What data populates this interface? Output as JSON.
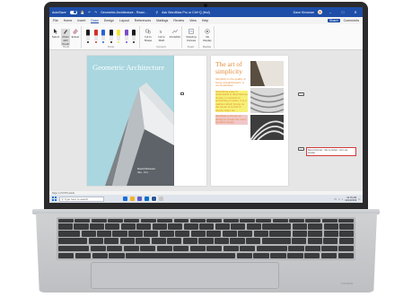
{
  "device": {
    "logo": "Lenovo"
  },
  "word": {
    "titlebar": {
      "autosave_label": "AutoSave",
      "autosave_state": "On",
      "doc_title": "Geometric Architecture - Read...",
      "search_placeholder": "Ask WordMax Pro or Ctrl+Q (find)",
      "user_name": "Dave Kinsman"
    },
    "tabs": [
      "File",
      "Home",
      "Insert",
      "Draw",
      "Design",
      "Layout",
      "References",
      "Mailings",
      "Review",
      "View",
      "Help"
    ],
    "active_tab": "Draw",
    "share_label": "Share",
    "comments_label": "Comments",
    "ribbon": {
      "groups": [
        {
          "label": "Tools",
          "tools": [
            "Select",
            "Draw with Touch",
            "Eraser"
          ]
        },
        {
          "label": "Pens"
        },
        {
          "label": "Convert",
          "tools": [
            "Ink to Shape",
            "Ink to Math",
            "Ink Editor"
          ]
        },
        {
          "label": "Insert",
          "tools": [
            "Drawing Canvas"
          ]
        },
        {
          "label": "Replay",
          "tools": [
            "Ink Replay"
          ]
        }
      ],
      "pen_colors": [
        "#1c1c1c",
        "#d2312c",
        "#2a61d6",
        "#1c1c1c",
        "#f5e53a",
        "#7a4cc7",
        "#1c1c1c"
      ]
    },
    "document": {
      "cover_title": "Geometric Architecture",
      "cover_author_line1": "David Monteiro",
      "cover_author_line2": "nbs · fmi",
      "page2_title": "The art of simplicity",
      "page2_para1": "Simplicity is the quality of being straightforward, or uncomplicated.",
      "page2_para2": "Something easy to understand is described as simple, in contrast to something complex. It is a tradition which brings us the sense of a kind of beauty when we",
      "page2_para3": "Simplicity is the art of design to create the most beautiful design",
      "comment_text": "Dave Kinsman  · this is perfect - let's use simpler"
    },
    "colors": {
      "word_blue": "#1e4ea8",
      "accent_orange": "#e38a36",
      "highlight_yellow": "#f6f176",
      "highlight_pink": "#f1c7c9",
      "comment_red": "#d23a3a"
    }
  },
  "taskbar": {
    "search_placeholder": "Type here to search",
    "time": "10:15 AM",
    "date": "12/13/2019"
  },
  "statusbar": {
    "page_info": "Page 1 of 8   876 words"
  }
}
